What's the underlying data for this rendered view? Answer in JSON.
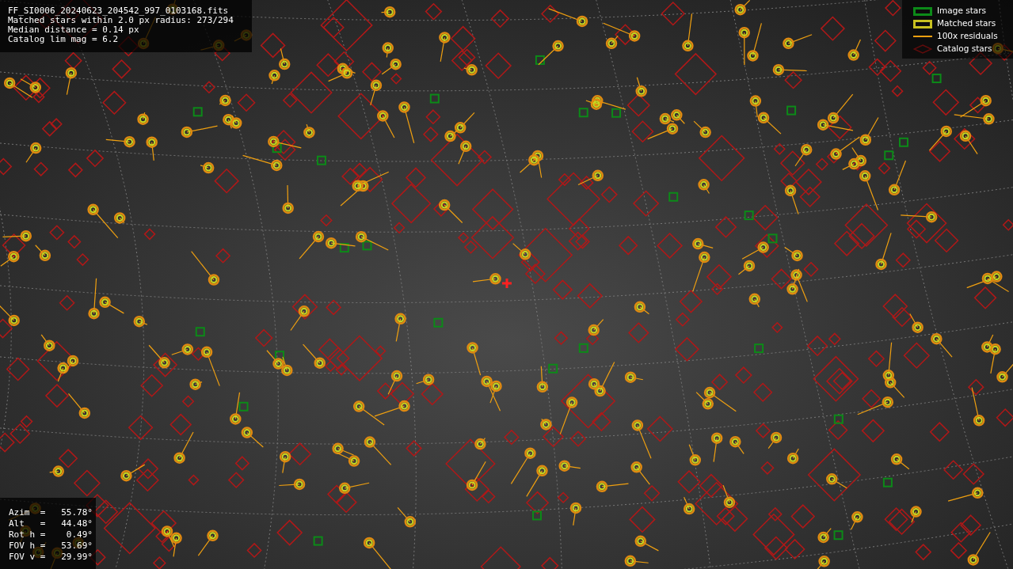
{
  "info_lines": [
    "FF_SI0006_20240623_204542_997_0103168.fits",
    "Matched stars within 2.0 px radius: 273/294",
    "Median distance = 0.14 px",
    "Catalog lim mag = 6.2"
  ],
  "legend": [
    {
      "kind": "image",
      "label": "Image stars"
    },
    {
      "kind": "matched",
      "label": "Matched stars"
    },
    {
      "kind": "residual",
      "label": "100x residuals"
    },
    {
      "kind": "catalog",
      "label": "Catalog stars"
    }
  ],
  "pointing": [
    {
      "label": "Azim  =",
      "value": "55.78°"
    },
    {
      "label": "Alt   =",
      "value": "44.48°"
    },
    {
      "label": "Rot h =",
      "value": " 0.49°"
    },
    {
      "label": "FOV h =",
      "value": "53.69°"
    },
    {
      "label": "FOV v =",
      "value": "29.99°"
    }
  ]
}
